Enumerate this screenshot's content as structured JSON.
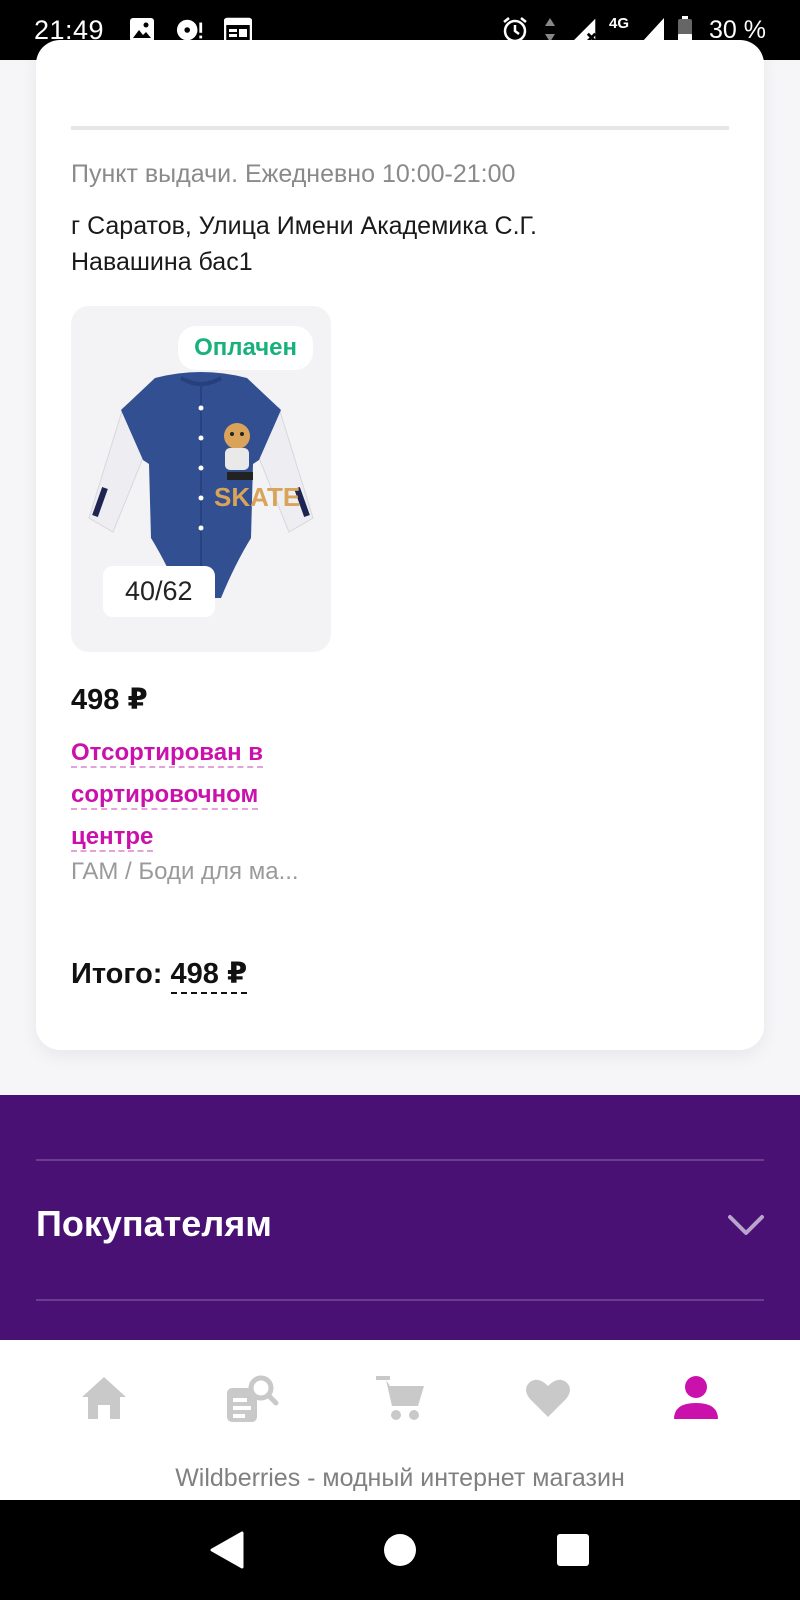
{
  "status_bar": {
    "time": "21:49",
    "battery_percent": "30 %",
    "network": "4G",
    "icons": [
      "image-icon",
      "media-icon",
      "calendar-icon",
      "alarm-icon",
      "signal-icon",
      "battery-icon"
    ]
  },
  "order": {
    "pickup_label": "Пункт выдачи. Ежедневно 10:00-21:00",
    "address": "г Саратов, Улица Имени Академика С.Г. Навашина бас1",
    "item": {
      "paid_badge": "Оплачен",
      "size": "40/62",
      "price": "498 ₽",
      "status": "Отсортирован в сортировочном центре",
      "name": "ГАМ / Боди для ма...",
      "image_print_text": "SKATE"
    },
    "total_label": "Итого:",
    "total_amount": "498 ₽"
  },
  "footer": {
    "section_title": "Покупателям"
  },
  "bottom_nav": {
    "items": [
      "home-icon",
      "catalog-search-icon",
      "cart-icon",
      "favorites-icon",
      "profile-icon"
    ],
    "active": "profile-icon",
    "caption": "Wildberries - модный интернет магазин"
  },
  "colors": {
    "accent": "#cb11ab",
    "paid": "#19b17b",
    "footer_bg": "#481173",
    "nav_inactive": "#c9c9c9"
  }
}
